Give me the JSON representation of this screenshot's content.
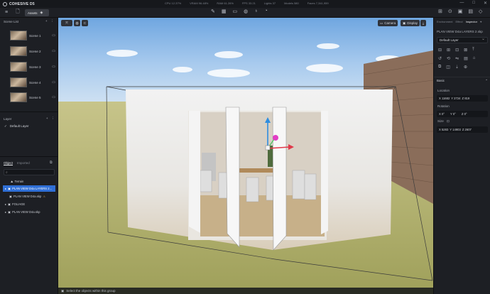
{
  "app": {
    "title": "COHESIVE D5"
  },
  "titlebar": {
    "stats": [
      "CPU 12.37%",
      "VRAM 96.48%",
      "RAM 61.26%",
      "FPS 33.21",
      "Lights 37",
      "Models 580",
      "Faces 7,341,959"
    ],
    "window_buttons": [
      "—",
      "□",
      "✕"
    ]
  },
  "toolbar": {
    "assets_label": "Assets",
    "center_tools": [
      "✎",
      "▦",
      "▭",
      "◍",
      "♁",
      "◔"
    ],
    "right_tools": [
      "⊞",
      "⊙",
      "▣",
      "▤",
      "◇"
    ]
  },
  "left_panel": {
    "scene_list_title": "Scene List",
    "scenes": [
      "Scene 1",
      "Scene 2",
      "Scene 3",
      "Scene 4",
      "Scene 5"
    ],
    "layer_title": "Layer",
    "layer_items": [
      "Default Layer"
    ],
    "tabs": [
      "Object",
      "Imported"
    ],
    "objects": [
      {
        "label": "Terrain",
        "icon": "⛰",
        "selected": false
      },
      {
        "label": "PLAN VIEW D4a LAYERS 2...",
        "icon": "▣",
        "selected": true
      },
      {
        "label": "PLAN VIEW D4a.skp",
        "icon": "▣",
        "selected": false
      },
      {
        "label": "FOLIAGE",
        "icon": "▸",
        "selected": false
      },
      {
        "label": "PLAN VIEW D4a.skp",
        "icon": "▸",
        "selected": false
      }
    ]
  },
  "viewport": {
    "camera_label": "Camera",
    "display_label": "Display",
    "status_text": "Select the objects within this group"
  },
  "right_panel": {
    "tabs": [
      "Environment",
      "Effect",
      "Inspector"
    ],
    "title": "PLAN VIEW D4a LAYERS 2.skp",
    "layer_select": "Default Layer",
    "basic_label": "Basic",
    "location_label": "Location",
    "location": {
      "x": "X 11682",
      "y": "Y 2724",
      "z": "Z 819"
    },
    "rotation_label": "Rotation",
    "rotation": {
      "x": "X 0°",
      "y": "Y 0°",
      "z": "Z 0°"
    },
    "size_label": "Size",
    "size": {
      "x": "X 5283",
      "y": "Y 14903",
      "z": "Z 2607"
    }
  },
  "colors": {
    "accent": "#2f6fd6",
    "panel": "#1d1f24",
    "sky": "#8bb8e8",
    "grass": "#b7b572"
  }
}
